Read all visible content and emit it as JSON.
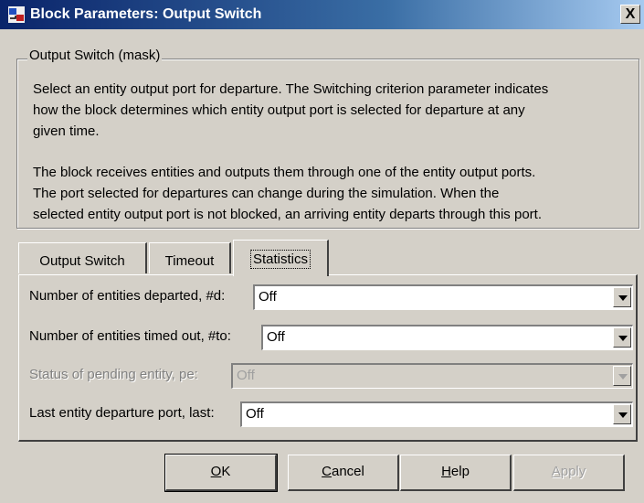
{
  "window": {
    "title": "Block Parameters: Output Switch",
    "close_label": "X"
  },
  "group": {
    "legend": "Output Switch (mask)",
    "desc1_line1": "Select an entity output port for departure. The Switching criterion parameter indicates",
    "desc1_line2": "how the block determines which entity output port is selected for departure at any",
    "desc1_line3": "given time.",
    "desc2_line1": "The block receives entities and outputs them through one of the entity output ports.",
    "desc2_line2": "The port selected for departures can change during the simulation. When the",
    "desc2_line3": "selected entity output port is not blocked, an arriving entity departs through this port."
  },
  "tabs": [
    {
      "label": "Output Switch",
      "active": false
    },
    {
      "label": "Timeout",
      "active": false
    },
    {
      "label": "Statistics",
      "active": true
    }
  ],
  "fields": [
    {
      "label": "Number of entities departed, #d:",
      "value": "Off",
      "enabled": true
    },
    {
      "label": "Number of entities timed out, #to:",
      "value": "Off",
      "enabled": true
    },
    {
      "label": "Status of pending entity, pe:",
      "value": "Off",
      "enabled": false
    },
    {
      "label": "Last entity departure port, last:",
      "value": "Off",
      "enabled": true
    }
  ],
  "buttons": {
    "ok_mnemonic": "O",
    "ok_rest": "K",
    "cancel_mnemonic": "C",
    "cancel_rest": "ancel",
    "help_mnemonic": "H",
    "help_rest": "elp",
    "apply_mnemonic": "A",
    "apply_rest": "pply"
  }
}
